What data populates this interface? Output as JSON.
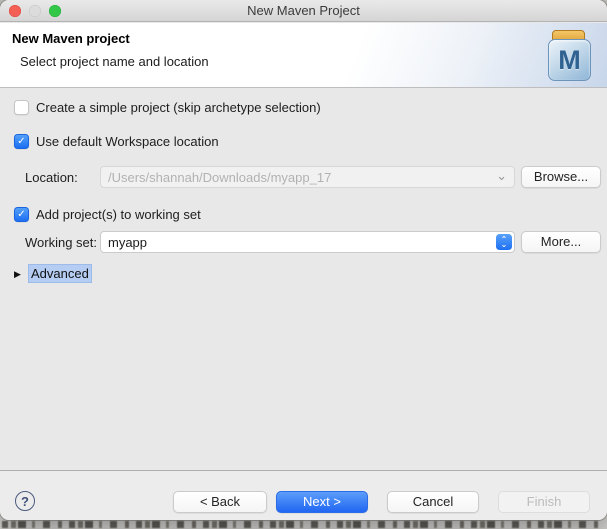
{
  "window": {
    "title": "New Maven Project"
  },
  "header": {
    "title": "New Maven project",
    "subtitle": "Select project name and location",
    "icon_letter": "M"
  },
  "form": {
    "simple_project_label": "Create a simple project (skip archetype selection)",
    "use_default_location_label": "Use default Workspace location",
    "location_label": "Location:",
    "location_value": "/Users/shannah/Downloads/myapp_17",
    "browse_label": "Browse...",
    "add_working_set_label": "Add project(s) to working set",
    "working_set_label": "Working set:",
    "working_set_value": "myapp",
    "more_label": "More...",
    "advanced_label": "Advanced",
    "states": {
      "simple_project_checked": false,
      "use_default_location_checked": true,
      "add_working_set_checked": true
    }
  },
  "footer": {
    "help_label": "?",
    "back_label": "< Back",
    "next_label": "Next >",
    "cancel_label": "Cancel",
    "finish_label": "Finish"
  },
  "icons": {
    "check": "✓",
    "chevron_down": "⌄",
    "stepper_up": "⌃",
    "stepper_down": "⌄",
    "disclosure_right": "▶"
  },
  "colors": {
    "accent_blue": "#2e7bf3",
    "selection_highlight": "#b5cdf2",
    "body_bg": "#e8e8e8"
  }
}
